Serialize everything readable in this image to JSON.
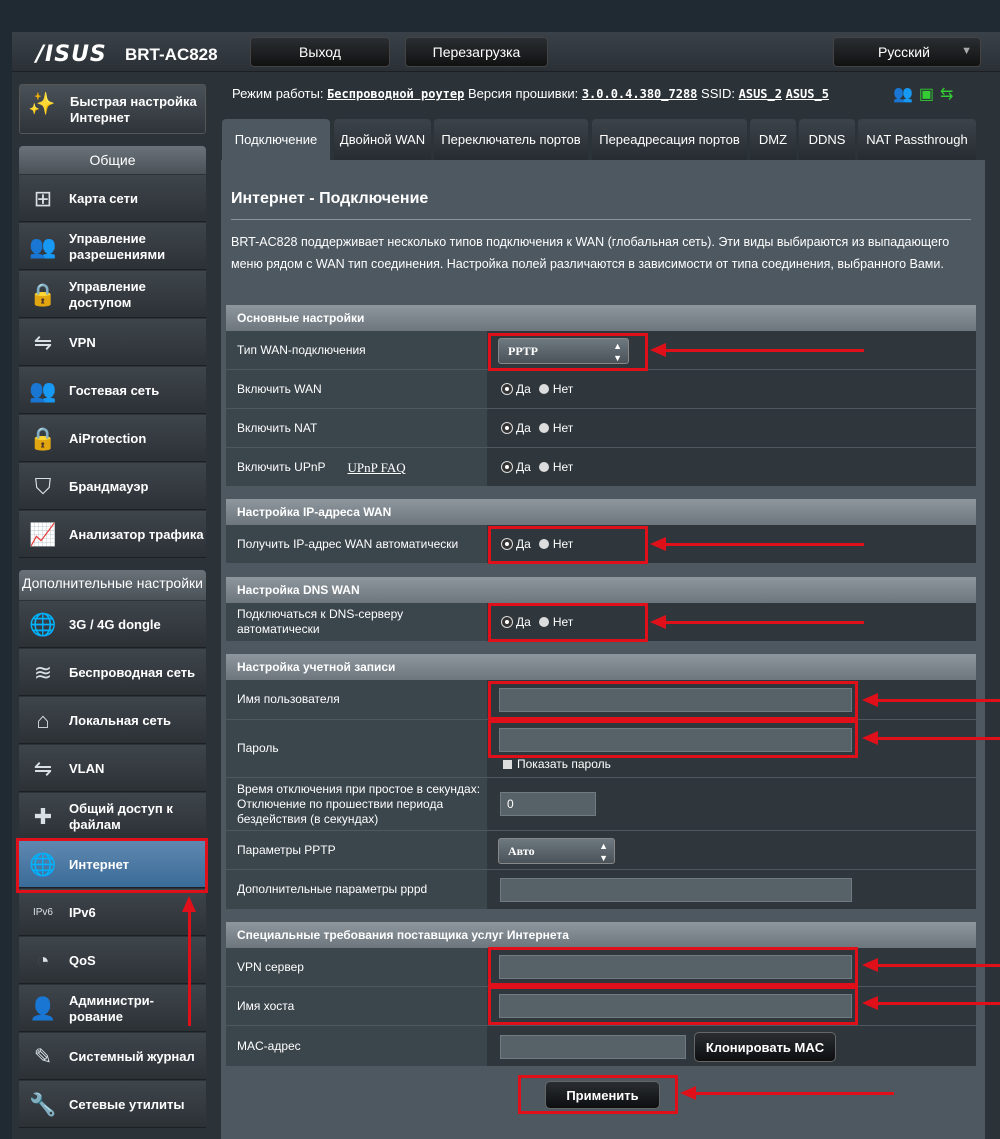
{
  "header": {
    "logo": "/ISUS",
    "model": "BRT-AC828",
    "logout_label": "Выход",
    "reboot_label": "Перезагрузка",
    "language": "Русский"
  },
  "status": {
    "mode_label": "Режим работы:",
    "mode_value": "Беспроводной роутер",
    "firmware_label": "Версия прошивки:",
    "firmware_value": "3.0.0.4.380_7288",
    "ssid_label": "SSID:",
    "ssid_1": "ASUS_2",
    "ssid_2": "ASUS_5"
  },
  "sidebar": {
    "quick_setup": "Быстрая настройка Интернет",
    "general_header": "Общие",
    "general_items": [
      {
        "label": "Карта сети",
        "icon": "network-map-icon"
      },
      {
        "label": "Управление разрешениями",
        "icon": "permissions-icon"
      },
      {
        "label": "Управление доступом",
        "icon": "access-lock-icon"
      },
      {
        "label": "VPN",
        "icon": "vpn-icon"
      },
      {
        "label": "Гостевая сеть",
        "icon": "guest-network-icon"
      },
      {
        "label": "AiProtection",
        "icon": "aiprotection-lock-icon"
      },
      {
        "label": "Брандмауэр",
        "icon": "firewall-shield-icon"
      },
      {
        "label": "Анализатор трафика",
        "icon": "traffic-analyzer-icon"
      }
    ],
    "advanced_header": "Дополнительные настройки",
    "advanced_items": [
      {
        "label": "3G / 4G dongle",
        "icon": "globe-icon"
      },
      {
        "label": "Беспроводная сеть",
        "icon": "wifi-icon"
      },
      {
        "label": "Локальная сеть",
        "icon": "home-icon"
      },
      {
        "label": "VLAN",
        "icon": "vlan-icon"
      },
      {
        "label": "Общий доступ к файлам",
        "icon": "puzzle-icon"
      },
      {
        "label": "Интернет",
        "icon": "globe-icon"
      },
      {
        "label": "IPv6",
        "icon": "ipv6-icon"
      },
      {
        "label": "QoS",
        "icon": "speedometer-icon"
      },
      {
        "label": "Администри-рование",
        "icon": "admin-user-icon"
      },
      {
        "label": "Системный журнал",
        "icon": "log-edit-icon"
      },
      {
        "label": "Сетевые утилиты",
        "icon": "tools-wrench-icon"
      }
    ]
  },
  "tabs": [
    "Подключение",
    "Двойной WAN",
    "Переключатель портов",
    "Переадресация портов",
    "DMZ",
    "DDNS",
    "NAT Passthrough"
  ],
  "content": {
    "title": "Интернет - Подключение",
    "description": "BRT-AC828 поддерживает несколько типов подключения к WAN (глобальная сеть). Эти виды выбираются из выпадающего меню рядом с WAN тип соединения. Настройка полей различаются в зависимости от типа соединения, выбранного Вами.",
    "yes": "Да",
    "no": "Нет",
    "basic": {
      "header": "Основные настройки",
      "wan_type_label": "Тип WAN-подключения",
      "wan_type_value": "PPTP",
      "enable_wan_label": "Включить WAN",
      "enable_nat_label": "Включить NAT",
      "enable_upnp_label": "Включить UPnP",
      "upnp_faq": "UPnP FAQ"
    },
    "ip": {
      "header": "Настройка IP-адреса WAN",
      "auto_ip_label": "Получить IP-адрес WAN автоматически"
    },
    "dns": {
      "header": "Настройка DNS WAN",
      "auto_dns_label": "Подключаться к DNS-серверу автоматически"
    },
    "account": {
      "header": "Настройка учетной записи",
      "username_label": "Имя пользователя",
      "username_value": "",
      "password_label": "Пароль",
      "password_value": "",
      "show_password": "Показать пароль",
      "idle_label": "Время отключения при простое в секундах: Отключение по прошествии периода бездействия (в секундах)",
      "idle_value": "0",
      "pptp_label": "Параметры PPTP",
      "pptp_value": "Авто",
      "pppd_label": "Дополнительные параметры pppd",
      "pppd_value": ""
    },
    "isp": {
      "header": "Специальные требования поставщика услуг Интернета",
      "vpn_server_label": "VPN сервер",
      "vpn_server_value": "",
      "hostname_label": "Имя хоста",
      "hostname_value": "",
      "mac_label": "MAC-адрес",
      "mac_value": "",
      "clone_mac": "Клонировать MAC"
    },
    "apply": "Применить"
  },
  "colors": {
    "annotation_red": "#e0101a",
    "active_nav": "#4a7aa6",
    "section_header": "#7d868d"
  }
}
